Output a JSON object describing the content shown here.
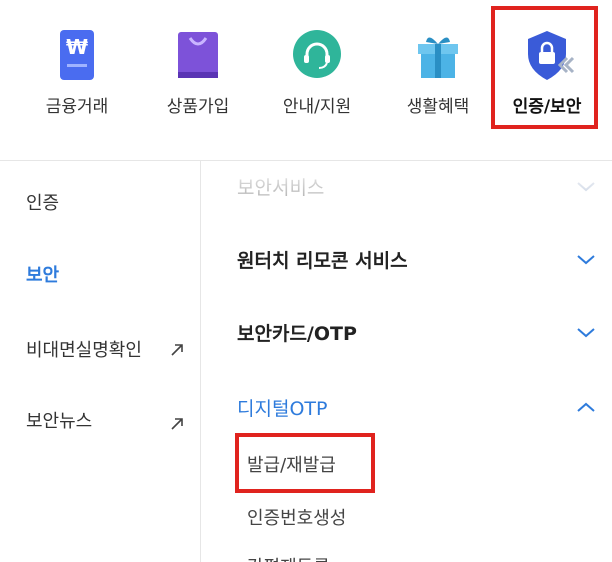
{
  "topnav": {
    "items": [
      {
        "label": "금융거래",
        "icon": "banking-wallet-icon",
        "color": "#4a6cf0"
      },
      {
        "label": "상품가입",
        "icon": "shopping-bag-icon",
        "color": "#7d52d9"
      },
      {
        "label": "안내/지원",
        "icon": "headset-support-icon",
        "color": "#2fb59a"
      },
      {
        "label": "생활혜택",
        "icon": "gift-box-icon",
        "color": "#4cb3e6"
      },
      {
        "label": "인증/보안",
        "icon": "security-shield-icon",
        "color": "#3a5bd8"
      }
    ],
    "active_index": 4
  },
  "leftmenu": {
    "items": [
      {
        "label": "인증"
      },
      {
        "label": "보안"
      },
      {
        "label": "비대면실명확인"
      },
      {
        "label": "보안뉴스"
      }
    ],
    "active": "보안"
  },
  "content": {
    "sections": [
      {
        "title": "보안서비스",
        "state": "collapsed"
      },
      {
        "title": "원터치 리모콘 서비스",
        "state": "collapsed"
      },
      {
        "title": "보안카드/OTP",
        "state": "collapsed"
      },
      {
        "title": "디지털OTP",
        "state": "expanded"
      }
    ],
    "sub_items": [
      {
        "label": "발급/재발급"
      },
      {
        "label": "인증번호생성"
      },
      {
        "label": "간편재등록"
      }
    ]
  },
  "colors": {
    "accent": "#2e7bdc",
    "highlight_box": "#e0231e"
  }
}
